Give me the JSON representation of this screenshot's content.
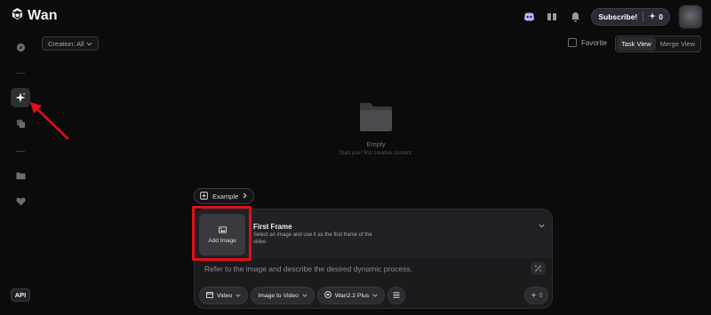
{
  "brand": {
    "name": "Wan"
  },
  "header": {
    "subscribe_label": "Subscribe!",
    "credits": "0"
  },
  "rail": {
    "items": [
      "explore-icon",
      "create-icon",
      "library-icon",
      "folder-icon",
      "heart-icon"
    ],
    "api_label": "API"
  },
  "filters": {
    "creation_label": "Creation: All",
    "favorite_label": "Favorite",
    "views": [
      "Task View",
      "Merge View"
    ],
    "active_view": "Task View"
  },
  "empty_state": {
    "title": "Empty",
    "subtitle": "Start your first creative content."
  },
  "example_label": "Example",
  "composer": {
    "add_image_label": "Add Image",
    "first_frame_title": "First Frame",
    "first_frame_desc": "Select an image and use it as the first frame of the video",
    "prompt_placeholder": "Refer to the image and describe the desired dynamic process.",
    "toolbar": {
      "mode_label": "Video",
      "task_label": "Image to Video",
      "model_label": "Wan2.2 Plus"
    },
    "send_credits": "0"
  },
  "colors": {
    "background": "#0b0b0c",
    "panel": "#1b1b1e",
    "highlight": "#e01016"
  }
}
